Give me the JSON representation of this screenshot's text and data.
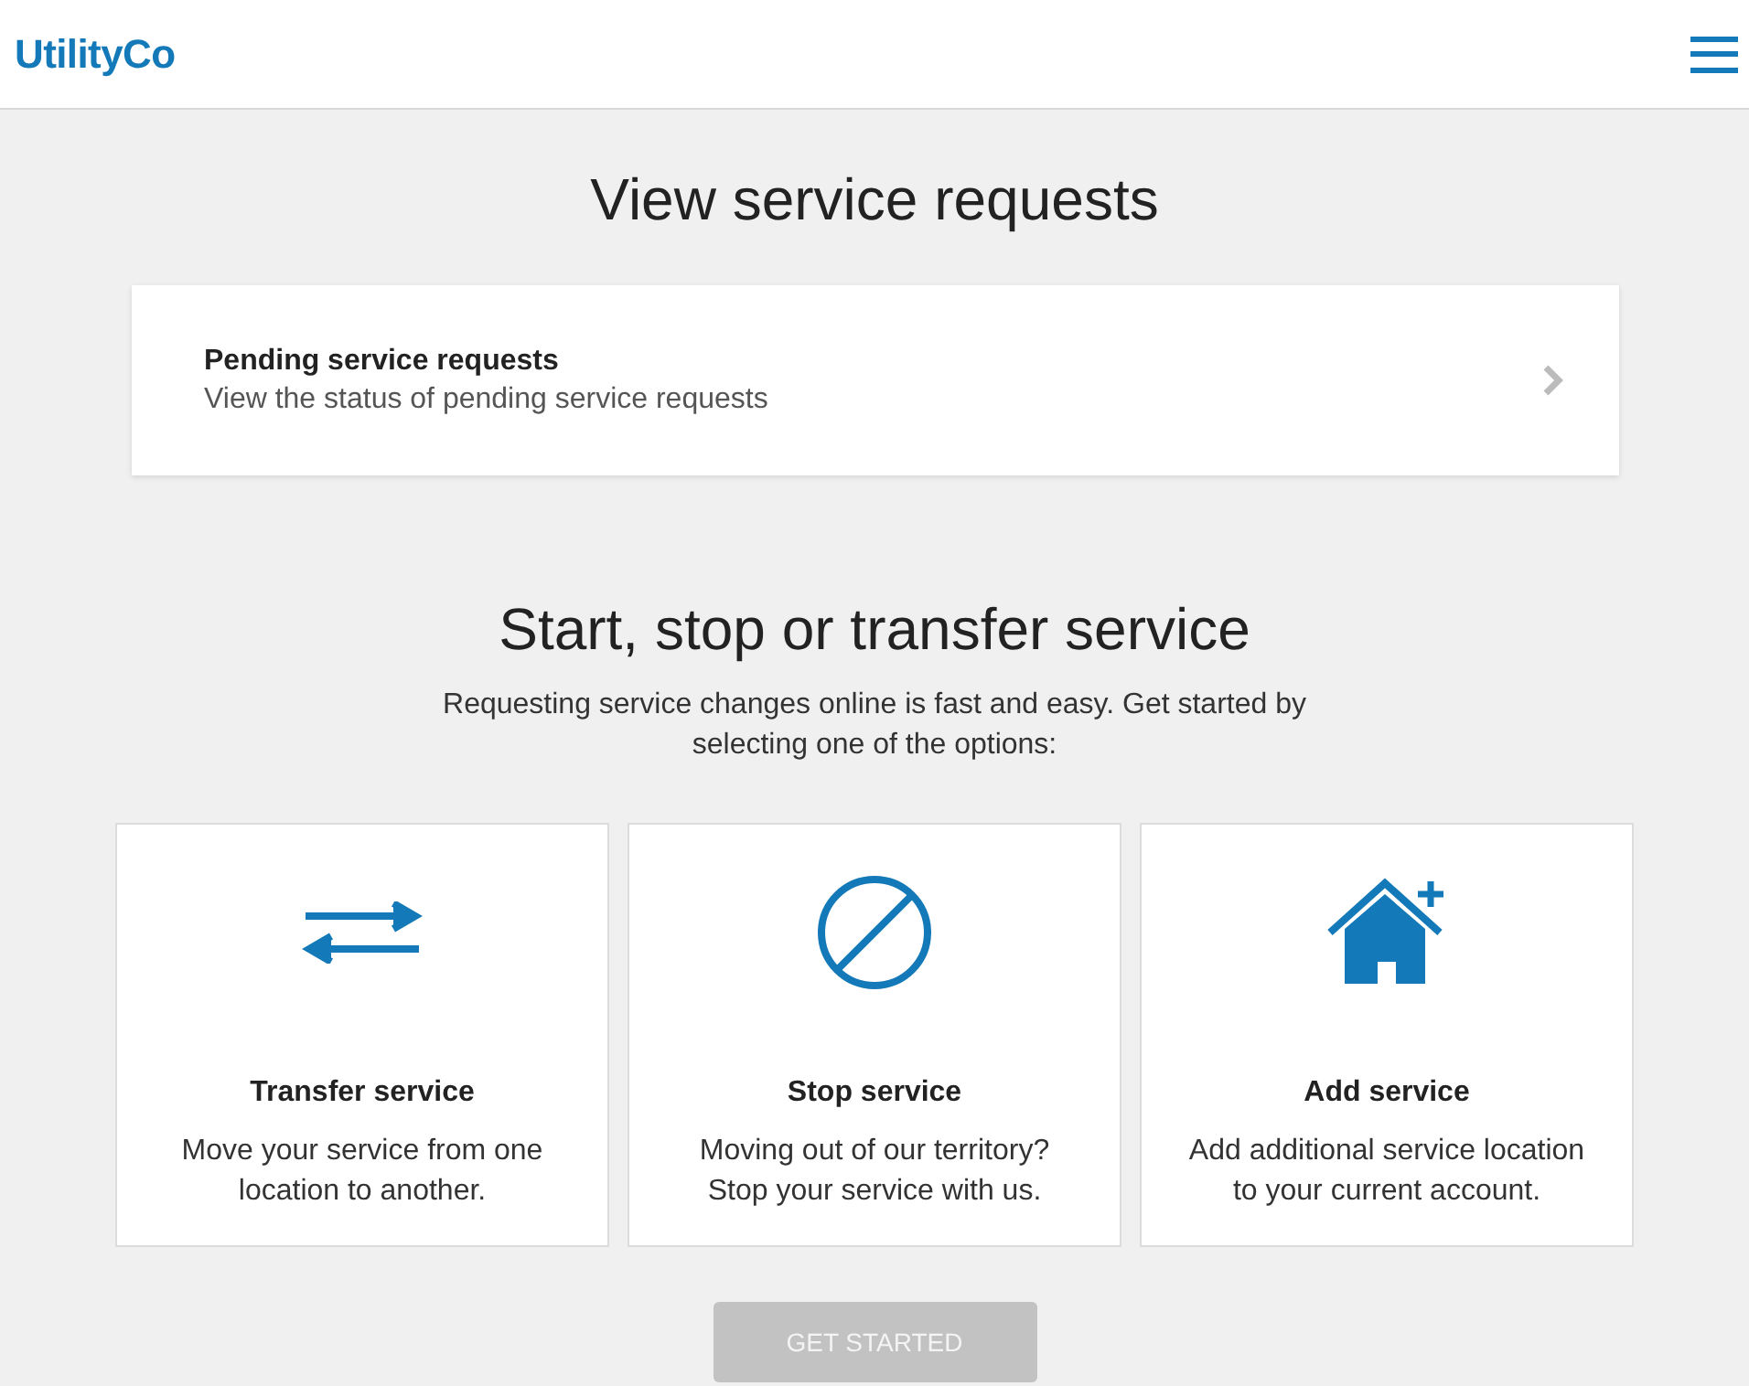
{
  "header": {
    "logo": "UtilityCo"
  },
  "page_title": "View service requests",
  "pending_card": {
    "title": "Pending service requests",
    "subtitle": "View the status of pending service requests"
  },
  "section": {
    "title": "Start, stop or transfer service",
    "description": "Requesting service changes online is fast and easy. Get started by selecting one of the options:"
  },
  "options": [
    {
      "kind": "transfer",
      "title": "Transfer service",
      "description": "Move your service from one location to another.",
      "selected": false
    },
    {
      "kind": "stop",
      "title": "Stop service",
      "description": "Moving out of our territory? Stop your service with us.",
      "selected": false
    },
    {
      "kind": "add",
      "title": "Add service",
      "description": "Add additional service location to your current account.",
      "selected": false
    }
  ],
  "button": {
    "label": "GET STARTED",
    "disabled": true
  }
}
